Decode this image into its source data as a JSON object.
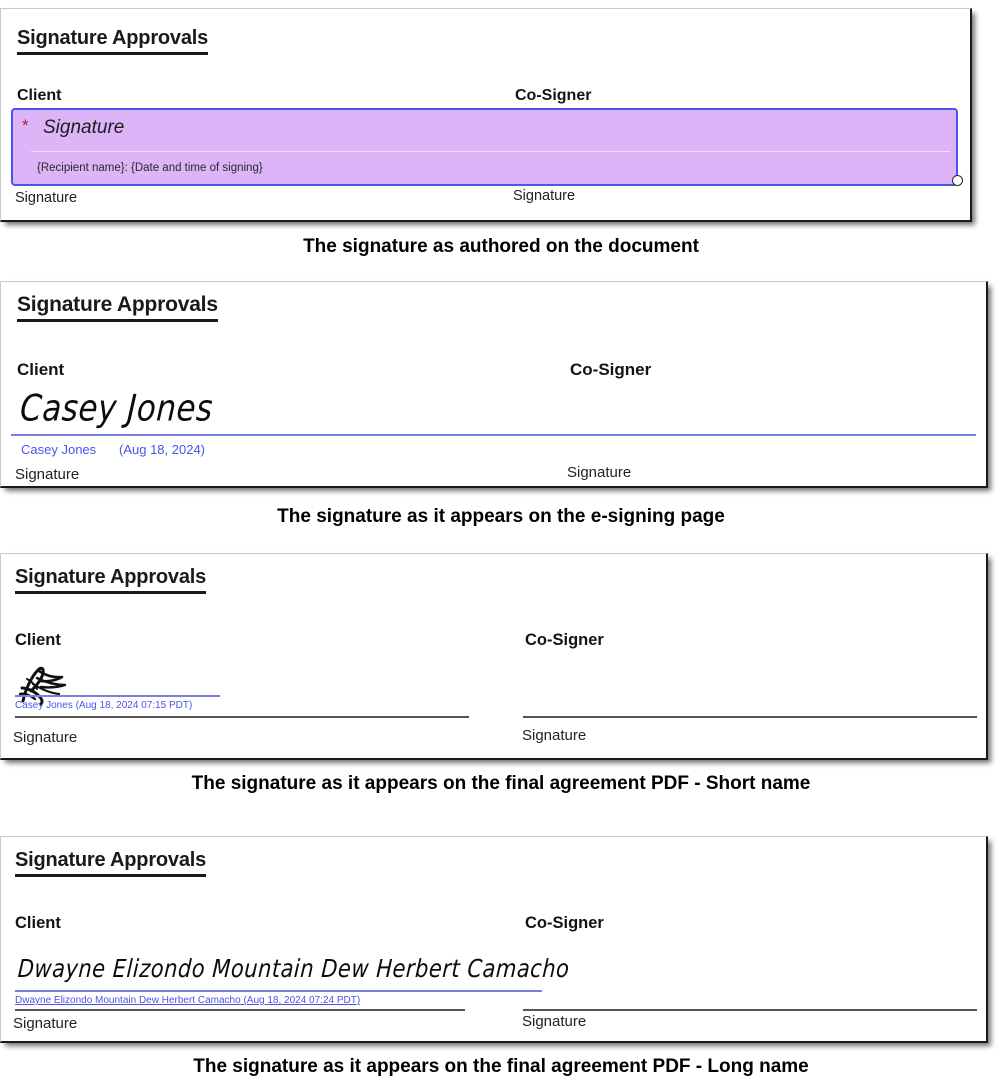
{
  "document": {
    "title": "Signature Approvals",
    "section_heading": "Signature Approvals",
    "columns": {
      "client": "Client",
      "cosigner": "Co-Signer"
    },
    "signature_label": "Signature"
  },
  "panels": [
    {
      "id": "authored",
      "heading": "Signature Approvals",
      "client_header": "Client",
      "cosigner_header": "Co-Signer",
      "client_signature_label": "Signature",
      "cosigner_signature_label": "Signature",
      "field": {
        "required_marker": "*",
        "placeholder": "Signature",
        "token_text": "{Recipient name}: {Date and time of signing}",
        "fill_color": "#dcb4f7",
        "border_color": "#4a54e8",
        "selected": true,
        "handle": "resize-handle"
      },
      "caption": "The signature as authored on the document"
    },
    {
      "id": "esigning",
      "heading": "Signature Approvals",
      "client_header": "Client",
      "cosigner_header": "Co-Signer",
      "client_signature_label": "Signature",
      "cosigner_signature_label": "Signature",
      "signature_script": "Casey Jones",
      "signer_name": "Casey Jones",
      "signed_date": "(Aug 18, 2024)",
      "rule_color": "#7b7fe0",
      "meta_color": "#4a54e8",
      "caption": "The signature as it appears on the e-signing page"
    },
    {
      "id": "pdf-short-name",
      "heading": "Signature Approvals",
      "client_header": "Client",
      "cosigner_header": "Co-Signer",
      "client_signature_label": "Signature",
      "cosigner_signature_label": "Signature",
      "signature_script": "ink-scribble",
      "signer_meta": "Casey Jones (Aug 18, 2024 07:15 PDT)",
      "rule_color": "#7b7fe0",
      "meta_color": "#4a54e8",
      "caption": "The signature as it appears on the final agreement PDF - Short name"
    },
    {
      "id": "pdf-long-name",
      "heading": "Signature Approvals",
      "client_header": "Client",
      "cosigner_header": "Co-Signer",
      "client_signature_label": "Signature",
      "cosigner_signature_label": "Signature",
      "signature_script": "Dwayne Elizondo Mountain Dew Herbert Camacho",
      "signer_meta": "Dwayne Elizondo Mountain Dew Herbert Camacho (Aug 18, 2024 07:24 PDT)",
      "rule_color": "#7b7fe0",
      "meta_color": "#4a54e8",
      "caption": "The signature as it appears on the final agreement PDF - Long name"
    }
  ]
}
